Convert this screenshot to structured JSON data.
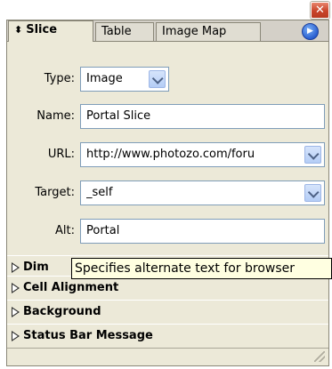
{
  "window": {
    "close_glyph": "✕"
  },
  "tabs": [
    {
      "label": "Slice",
      "active": true
    },
    {
      "label": "Table",
      "active": false
    },
    {
      "label": "Image Map",
      "active": false
    }
  ],
  "menu_glyph": "▶",
  "form": {
    "type_label": "Type:",
    "type_value": "Image",
    "name_label": "Name:",
    "name_value": "Portal Slice",
    "url_label": "URL:",
    "url_value": "http://www.photozo.com/foru",
    "target_label": "Target:",
    "target_value": "_self",
    "alt_label": "Alt:",
    "alt_value": "Portal"
  },
  "sections": [
    {
      "label": "Dim"
    },
    {
      "label": "Cell Alignment"
    },
    {
      "label": "Background"
    },
    {
      "label": "Status Bar Message"
    }
  ],
  "tooltip": "Specifies alternate text for browser",
  "icons": {
    "close": "close-icon",
    "menu": "panel-menu-icon",
    "dropdown": "chevron-down-icon",
    "expand": "triangle-right-icon",
    "sort": "up-down-arrows-icon"
  },
  "colors": {
    "panel_bg": "#ece9d8",
    "tooltip_bg": "#ffffe1",
    "close_red": "#c9442a",
    "field_border": "#7f9db9"
  }
}
